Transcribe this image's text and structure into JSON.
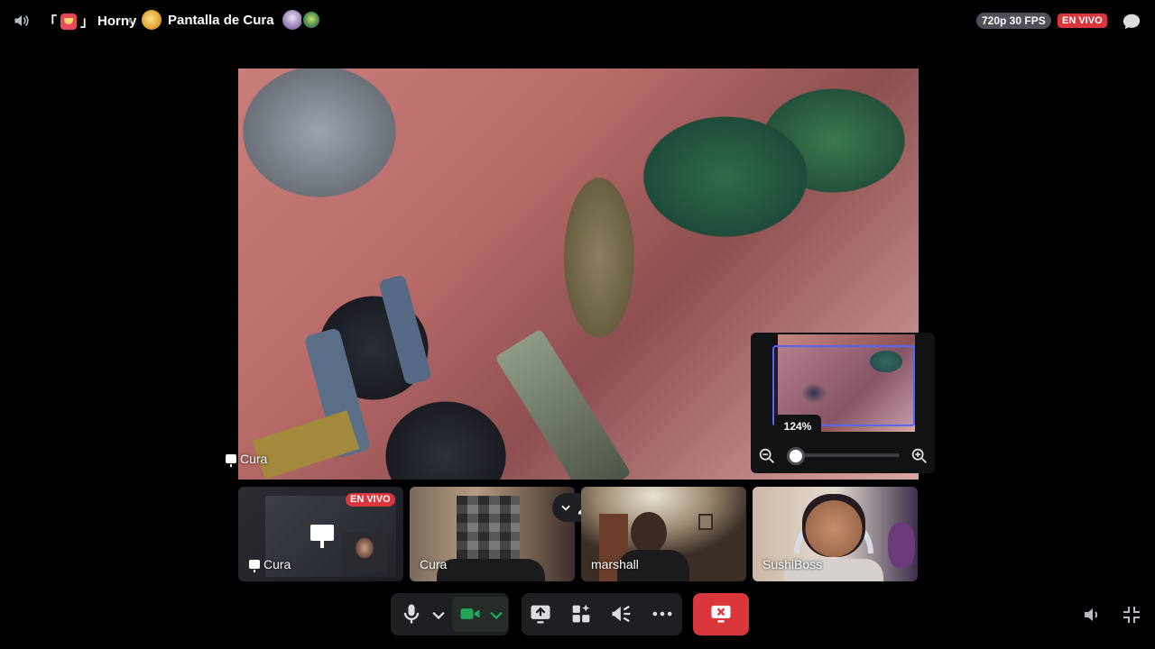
{
  "topbar": {
    "channel_prefix": "「",
    "channel_suffix": "」",
    "channel_name": "Horny",
    "stream_title": "Pantalla de Cura",
    "quality": "720p 30 FPS",
    "live_label": "EN VIVO"
  },
  "main_stream": {
    "name": "Cura"
  },
  "zoom": {
    "level": "124%"
  },
  "tiles": [
    {
      "name": "Cura",
      "type": "screen",
      "badge": "EN VIVO"
    },
    {
      "name": "Cura",
      "type": "camera"
    },
    {
      "name": "marshall",
      "type": "camera"
    },
    {
      "name": "SushiBoss",
      "type": "camera"
    }
  ],
  "colors": {
    "live": "#da373c",
    "accent": "#5865f2",
    "camera_on": "#23a55a",
    "panel": "#1e1f22"
  },
  "icons": {
    "top_left": "speaker-icon",
    "top_right": "chat-bubble-icon",
    "controls": [
      "microphone-icon",
      "chevron-down-icon",
      "video-camera-icon",
      "chevron-down-icon",
      "screen-share-icon",
      "activities-icon",
      "soundboard-icon",
      "more-icon",
      "disconnect-icon"
    ],
    "bottom_right": [
      "volume-icon",
      "collapse-icon"
    ]
  }
}
